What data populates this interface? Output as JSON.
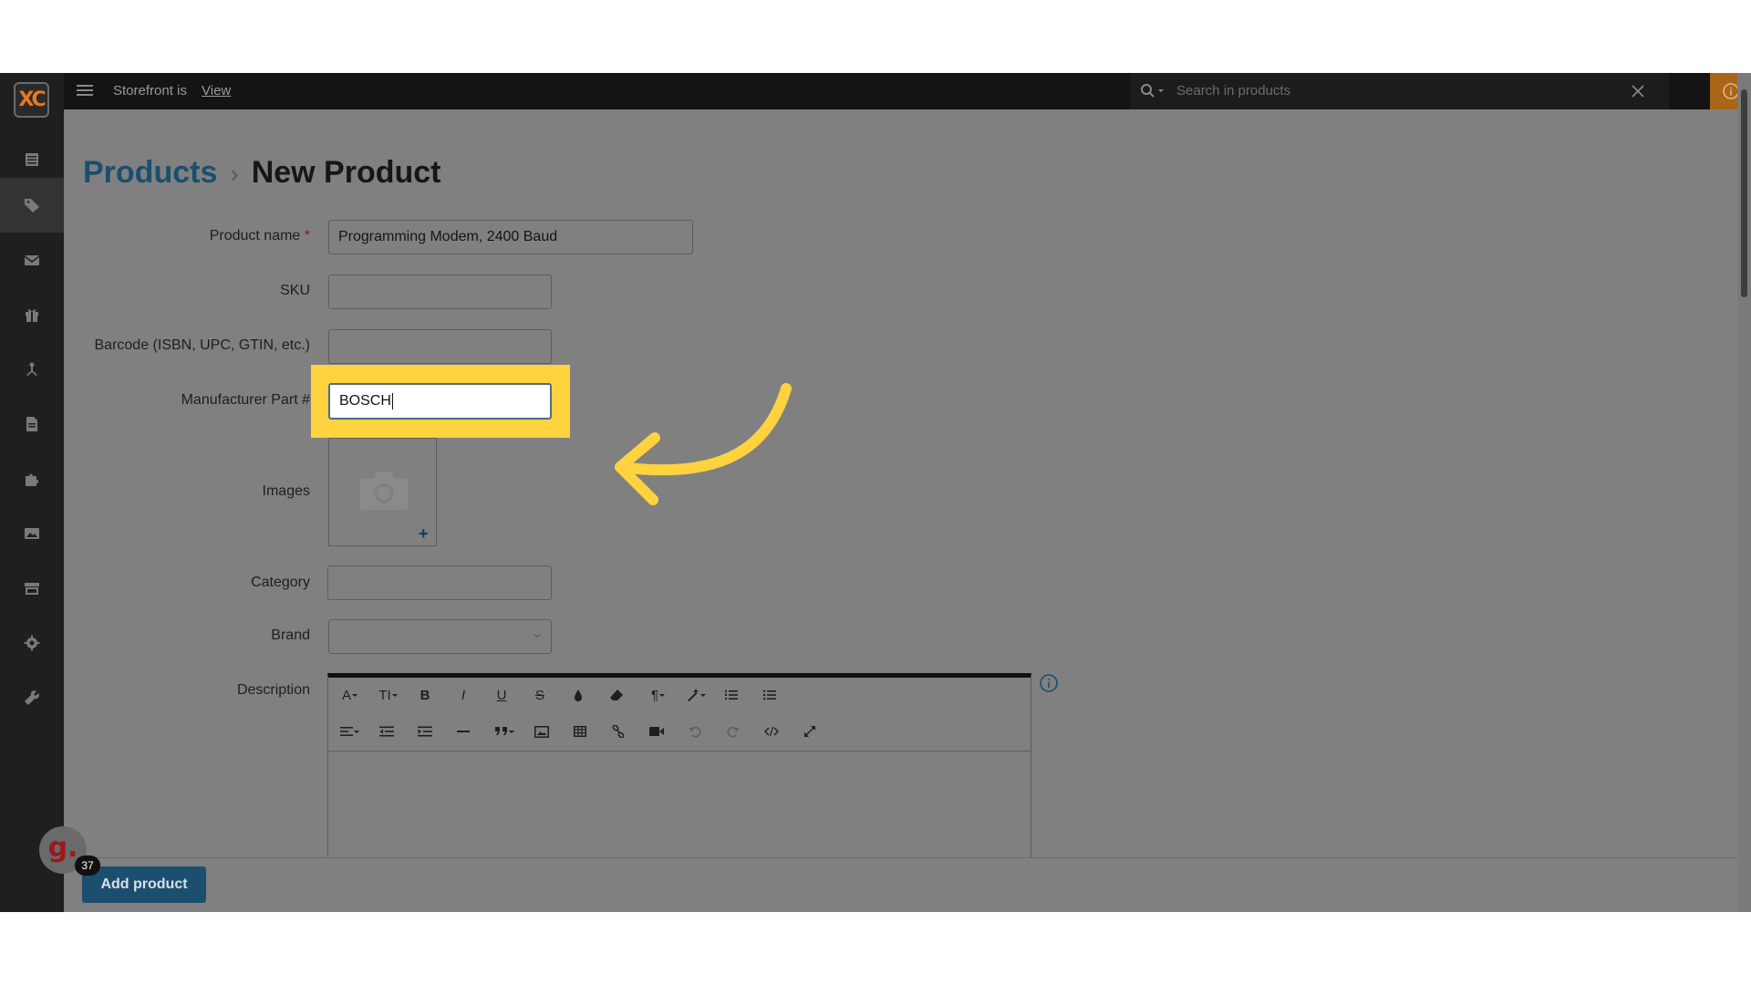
{
  "topbar": {
    "storefront_label": "Storefront is",
    "storefront_link": "View",
    "search_placeholder": "Search in products"
  },
  "logo": {
    "text": "XC"
  },
  "sidebar": {
    "icons": [
      "list-icon",
      "tag-icon",
      "envelope-icon",
      "gift-icon",
      "sitemap-icon",
      "file-icon",
      "puzzle-icon",
      "image-icon",
      "store-icon",
      "gear-icon",
      "wrench-icon"
    ],
    "active_index": 1
  },
  "breadcrumb": {
    "parent": "Products",
    "separator": "›",
    "current": "New Product"
  },
  "form": {
    "product_name": {
      "label": "Product name",
      "required_mark": "*",
      "value": "Programming Modem, 2400 Baud"
    },
    "sku": {
      "label": "SKU",
      "value": ""
    },
    "barcode": {
      "label": "Barcode (ISBN, UPC, GTIN, etc.)",
      "value": ""
    },
    "mpn": {
      "label": "Manufacturer Part #",
      "value": "BOSCH"
    },
    "images": {
      "label": "Images",
      "add_symbol": "+"
    },
    "category": {
      "label": "Category",
      "value": ""
    },
    "brand": {
      "label": "Brand",
      "value": ""
    },
    "description": {
      "label": "Description"
    }
  },
  "editor": {
    "row1": [
      "A",
      "TI",
      "B",
      "I",
      "U",
      "S",
      "drop-icon",
      "eraser-icon",
      "¶",
      "magic-icon",
      "ordered-list-icon",
      "unordered-list-icon"
    ],
    "row2": [
      "align-icon",
      "outdent-icon",
      "indent-icon",
      "hr-icon",
      "quote-icon",
      "image-icon",
      "table-icon",
      "link-icon",
      "video-icon",
      "undo-icon",
      "redo-icon",
      "code-icon",
      "fullscreen-icon"
    ]
  },
  "actions": {
    "add_product": "Add product"
  },
  "assistant": {
    "letter": "g.",
    "badge_count": "37"
  },
  "colors": {
    "highlight": "#ffd23f",
    "accent": "#1c4e6e",
    "brand_orange": "#e9781f"
  }
}
